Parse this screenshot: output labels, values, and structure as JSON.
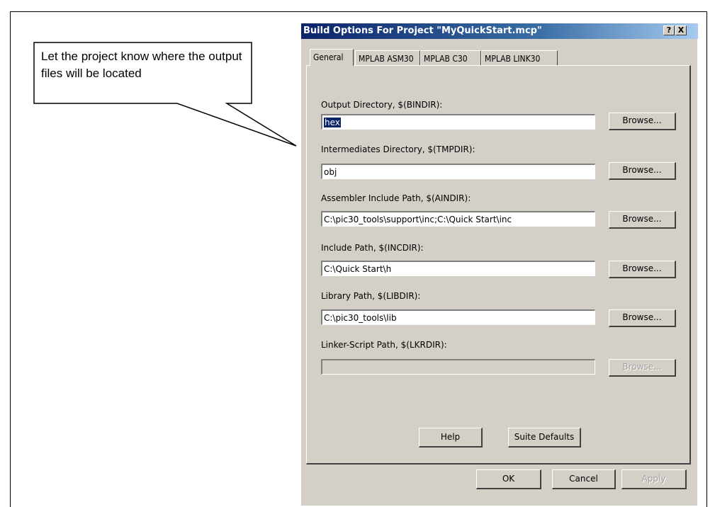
{
  "callout": {
    "text": "Let the project know where the output files will be located"
  },
  "dialog": {
    "title": "Build Options For Project \"MyQuickStart.mcp\"",
    "help_button": "?",
    "close_button": "X",
    "tabs": [
      "General",
      "MPLAB ASM30",
      "MPLAB C30",
      "MPLAB LINK30"
    ],
    "fields": [
      {
        "label": "Output Directory, $(BINDIR):",
        "value": "hex",
        "browse": "Browse..."
      },
      {
        "label": "Intermediates Directory, $(TMPDIR):",
        "value": "obj",
        "browse": "Browse..."
      },
      {
        "label": "Assembler Include Path, $(AINDIR):",
        "value": "C:\\pic30_tools\\support\\inc;C:\\Quick Start\\inc",
        "browse": "Browse..."
      },
      {
        "label": "Include Path, $(INCDIR):",
        "value": "C:\\Quick Start\\h",
        "browse": "Browse..."
      },
      {
        "label": "Library Path, $(LIBDIR):",
        "value": "C:\\pic30_tools\\lib",
        "browse": "Browse..."
      },
      {
        "label": "Linker-Script Path, $(LKRDIR):",
        "value": "",
        "browse": "Browse..."
      }
    ],
    "help_label": "Help",
    "suite_defaults_label": "Suite Defaults",
    "ok_label": "OK",
    "cancel_label": "Cancel",
    "apply_label": "Apply"
  }
}
